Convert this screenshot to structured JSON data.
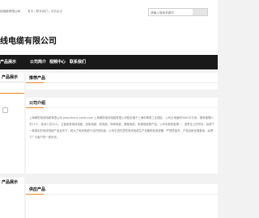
{
  "topbar": {
    "company": "线电缆有限公司",
    "links": "首页 | 联系我们 | 手机站点",
    "search_placeholder": "请输入搜索关键词"
  },
  "header": {
    "title": "线电缆有限公司"
  },
  "nav": {
    "items": [
      "产品展示",
      "公司简介",
      "视频中心",
      "联系我们"
    ]
  },
  "sidebar": {
    "blocks": [
      {
        "title": "产品展示"
      },
      {
        "title": ""
      },
      {
        "title": "产品展示"
      }
    ]
  },
  "panels": {
    "recommended": {
      "title": "推荐产品"
    },
    "intro": {
      "title": "公司介绍",
      "text": "上海闻阳电线电缆有限公司 www.fenny-cable.com 上海闻阳电线电缆有限公司是坐落于上海市奉贤工业园区，公司占地面积3000平方米，拥有管理人员17人，技术人员20人。主营各种电线电缆、控制电缆、软电缆、特种电缆、屏蔽电缆、电梯电缆等产品，公司本着质量第一、信誉至上的宗旨，赢得了一批稳定的电线电缆产品合作方，成为了电线电缆行业的佼佼者。公司引进先进的电线电缆生产设备和检测设备，严把质量关，产品远销全国各地，赢得了广大客户的一致好评。"
    },
    "latest": {
      "title": "供应产品"
    }
  }
}
